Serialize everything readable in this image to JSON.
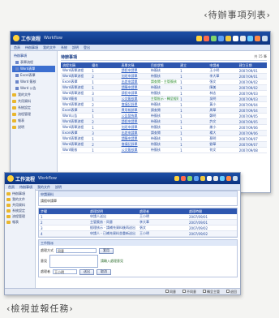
{
  "captions": {
    "top": "‹待辦事項列表›",
    "bottom": "‹檢視並報任務›"
  },
  "app": {
    "title": "工作流程",
    "subtitle": "Workflow"
  },
  "colors": {
    "titlebar": "#1d4fa6",
    "header_row": "#2e57b0",
    "selected": "#3c6fd0",
    "folder": "#e9b62c"
  },
  "icons": [
    "#ffd23a",
    "#ff6a4a",
    "#7fd46b",
    "#5da0f5",
    "#f0c840",
    "#ffffff",
    "#e7e7e7",
    "#66ccff",
    "#ff8844",
    "#cde"
  ],
  "win1": {
    "menu": [
      "首頁",
      "待辦事項",
      "我的文件",
      "系統",
      "說明",
      "登出"
    ],
    "sidebar": {
      "header": "待辦事項",
      "items": [
        {
          "label": "表單流程",
          "type": "doc",
          "sub": true,
          "sel": false
        },
        {
          "label": "Word表單",
          "type": "doc",
          "sub": true,
          "sel": true
        },
        {
          "label": "Excel表單",
          "type": "doc",
          "sub": true,
          "sel": false
        },
        {
          "label": "Word 簽核",
          "type": "doc",
          "sub": true,
          "sel": false
        },
        {
          "label": "Word 公告",
          "type": "doc",
          "sub": true,
          "sel": false
        },
        {
          "label": "我的文件",
          "type": "folder",
          "sub": false,
          "sel": false
        },
        {
          "label": "共用資料",
          "type": "folder",
          "sub": false,
          "sel": false
        },
        {
          "label": "系統設定",
          "type": "folder",
          "sub": false,
          "sel": false
        },
        {
          "label": "流程管理",
          "type": "folder",
          "sub": false,
          "sel": false
        },
        {
          "label": "報表",
          "type": "folder",
          "sub": false,
          "sel": false
        },
        {
          "label": "說明",
          "type": "folder",
          "sub": false,
          "sel": false
        }
      ]
    },
    "main": {
      "title": "待辦事項",
      "note": "共 15 筆",
      "columns": [
        "流程名稱",
        "優先",
        "表單名稱",
        "目前狀態",
        "建立",
        "申請者",
        "建立日期"
      ],
      "rows": [
        [
          "Word表單流程",
          "1",
          "請假申請單",
          "待簽核",
          "1",
          "王小明",
          "2007/09/01"
        ],
        [
          "Word表單流程",
          "2",
          "加班申請單",
          "待簽核",
          "1",
          "李大華",
          "2007/09/01"
        ],
        [
          "Excel表單",
          "1",
          "出差申請單",
          "請查閱 - 主管簽核",
          "1",
          "張文",
          "2007/09/02"
        ],
        [
          "Word表單流程",
          "1",
          "請購申請單",
          "待簽核",
          "1",
          "陳美",
          "2007/09/02"
        ],
        [
          "Word表單流程",
          "3",
          "請假申請單",
          "待簽核",
          "1",
          "林志",
          "2007/09/03"
        ],
        [
          "Word簽核",
          "1",
          "公文簽核單",
          "主管批示 - 轉呈經理核示",
          "1",
          "吳明",
          "2007/09/03"
        ],
        [
          "Word表單流程",
          "2",
          "會議記錄單",
          "待簽核",
          "1",
          "黃小",
          "2007/09/04"
        ],
        [
          "Excel表單",
          "1",
          "費用報銷單",
          "請查閱",
          "1",
          "周華",
          "2007/09/04"
        ],
        [
          "Word公告",
          "1",
          "公告發佈單",
          "待簽核",
          "1",
          "鄭明",
          "2007/09/05"
        ],
        [
          "Word表單流程",
          "2",
          "請假申請單",
          "待簽核",
          "1",
          "許文",
          "2007/09/05"
        ],
        [
          "Word表單流程",
          "1",
          "加班申請單",
          "待簽核",
          "1",
          "謝小",
          "2007/09/06"
        ],
        [
          "Excel表單",
          "3",
          "出差申請單",
          "請查閱",
          "1",
          "楊大",
          "2007/09/06"
        ],
        [
          "Word表單流程",
          "1",
          "請購申請單",
          "待簽核",
          "1",
          "蔡明",
          "2007/09/07"
        ],
        [
          "Word表單流程",
          "2",
          "會議記錄單",
          "待簽核",
          "1",
          "劉華",
          "2007/09/07"
        ],
        [
          "Word簽核",
          "1",
          "公文簽核單",
          "待簽核",
          "1",
          "何文",
          "2007/09/08"
        ]
      ]
    }
  },
  "win2": {
    "menu": [
      "首頁",
      "待辦事項",
      "我的文件",
      "說明"
    ],
    "sidebar": [
      "待辦事項",
      "我的文件",
      "共用資料",
      "系統設定",
      "流程管理",
      "報表"
    ],
    "info_head": "申請資料",
    "info_text": "請假申請單",
    "history_head": "簽核記錄",
    "history_columns": [
      "步驟",
      "處理說明",
      "處理者",
      "處理時間"
    ],
    "history_rows": [
      [
        "1",
        "申請人送出",
        "王小明",
        "2007/09/01"
      ],
      [
        "2",
        "主管簽核 - 同意",
        "李大華",
        "2007/09/01"
      ],
      [
        "3",
        "經理核示 - 請補充資料後再送出",
        "張文",
        "2007/09/02"
      ],
      [
        "4",
        "申請人 - 已補充資料並重新送出",
        "王小明",
        "2007/09/02"
      ]
    ],
    "task_head": "工作指派",
    "form": {
      "assign_label": "處理方式",
      "assign_value": "同意",
      "apply_btn": "套用",
      "opinion_label": "意見",
      "opinion_value": "",
      "hint": "請輸入處理意見",
      "user_label": "處理者",
      "user_value": "王小明",
      "send_btn": "送出",
      "cancel_btn": "取消"
    },
    "status": [
      "同意",
      "不同意",
      "轉呈主管",
      "退回"
    ]
  }
}
